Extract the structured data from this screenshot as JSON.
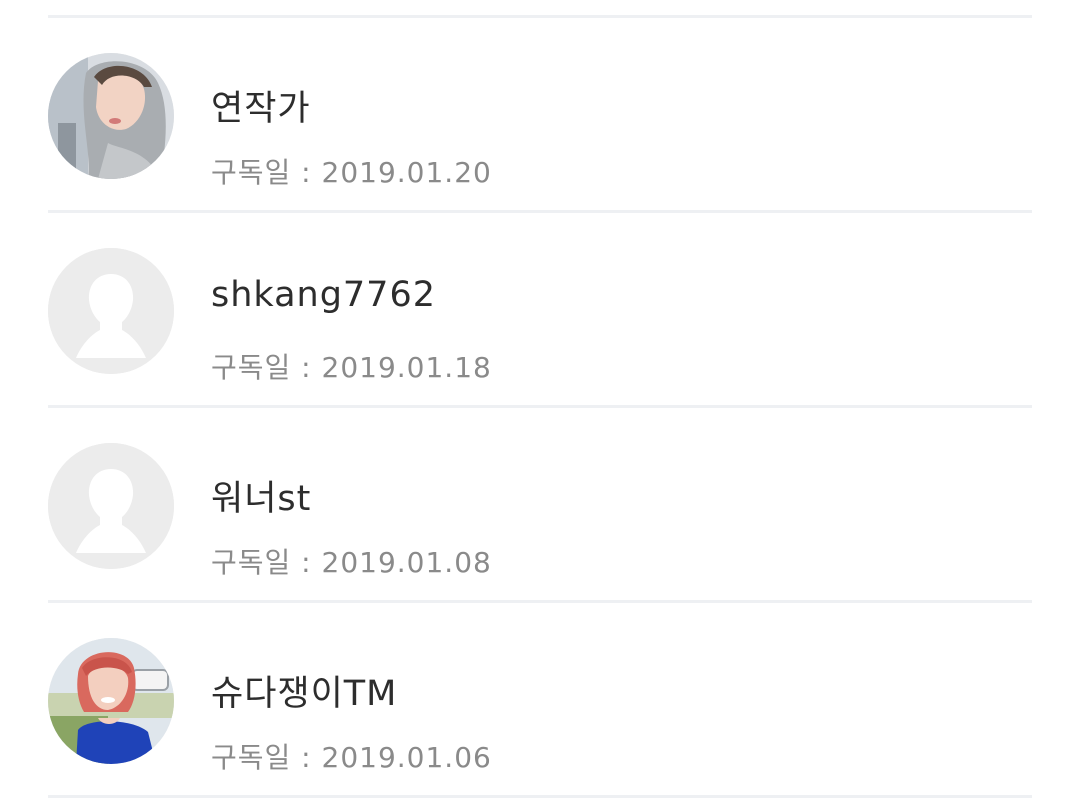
{
  "subscribers": [
    {
      "name": "연작가",
      "date_label": "구독일 : 2019.01.20",
      "avatar": "photo-hooded-person"
    },
    {
      "name": "shkang7762",
      "date_label": "구독일 : 2019.01.18",
      "avatar": "default-person-icon"
    },
    {
      "name": "워너st",
      "date_label": "구독일 : 2019.01.08",
      "avatar": "default-person-icon"
    },
    {
      "name": "슈다쟁이TM",
      "date_label": "구독일 : 2019.01.06",
      "avatar": "photo-red-hair-person"
    }
  ]
}
